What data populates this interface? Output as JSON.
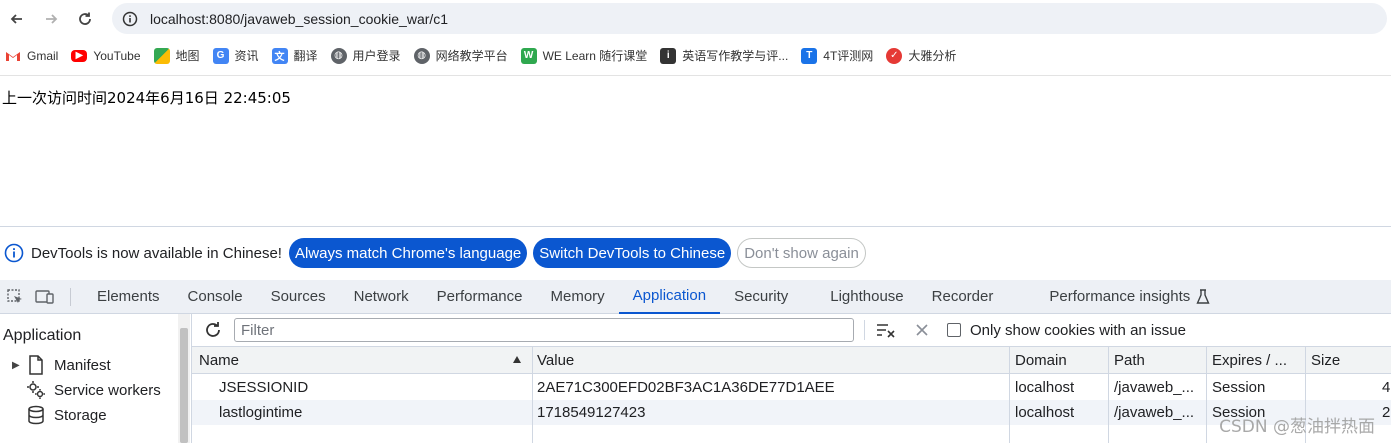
{
  "browser": {
    "url": "localhost:8080/javaweb_session_cookie_war/c1"
  },
  "bookmarks": [
    {
      "label": "Gmail",
      "icon": "gmail-icon",
      "color": "#ea4335"
    },
    {
      "label": "YouTube",
      "icon": "youtube-icon",
      "color": "#ff0000"
    },
    {
      "label": "地图",
      "icon": "maps-icon",
      "color": "#34a853"
    },
    {
      "label": "资讯",
      "icon": "news-icon",
      "color": "#4285f4"
    },
    {
      "label": "翻译",
      "icon": "translate-icon",
      "color": "#4285f4"
    },
    {
      "label": "用户登录",
      "icon": "globe-icon",
      "color": "#5f6368"
    },
    {
      "label": "网络教学平台",
      "icon": "globe-icon",
      "color": "#5f6368"
    },
    {
      "label": "WE Learn 随行课堂",
      "icon": "welearn-icon",
      "color": "#2fa84f"
    },
    {
      "label": "英语写作教学与评...",
      "icon": "writing-icon",
      "color": "#333333"
    },
    {
      "label": "4T评测网",
      "icon": "4t-icon",
      "color": "#1a73e8"
    },
    {
      "label": "大雅分析",
      "icon": "daya-icon",
      "color": "#e53935"
    }
  ],
  "page": {
    "text": "上一次访问时间2024年6月16日 22:45:05"
  },
  "devtools": {
    "infobar": {
      "message": "DevTools is now available in Chinese!",
      "btn_match": "Always match Chrome's language",
      "btn_switch": "Switch DevTools to Chinese",
      "btn_dismiss": "Don't show again"
    },
    "tabs": [
      "Elements",
      "Console",
      "Sources",
      "Network",
      "Performance",
      "Memory",
      "Application",
      "Security",
      "Lighthouse",
      "Recorder",
      "Performance insights"
    ],
    "active_tab": "Application",
    "sidebar": {
      "title": "Application",
      "items": [
        "Manifest",
        "Service workers",
        "Storage"
      ]
    },
    "filter": {
      "placeholder": "Filter",
      "checkbox_label": "Only show cookies with an issue"
    },
    "table": {
      "headers": [
        "Name",
        "Value",
        "Domain",
        "Path",
        "Expires / ...",
        "Size"
      ],
      "rows": [
        {
          "name": "JSESSIONID",
          "value": "2AE71C300EFD02BF3AC1A36DE77D1AEE",
          "domain": "localhost",
          "path": "/javaweb_...",
          "expires": "Session",
          "size": "4"
        },
        {
          "name": "lastlogintime",
          "value": "1718549127423",
          "domain": "localhost",
          "path": "/javaweb_...",
          "expires": "Session",
          "size": "2"
        }
      ]
    }
  },
  "watermark": "CSDN @葱油拌热面",
  "colors": {
    "accent": "#0b57d0",
    "tabbar_bg": "#edf0f5"
  }
}
